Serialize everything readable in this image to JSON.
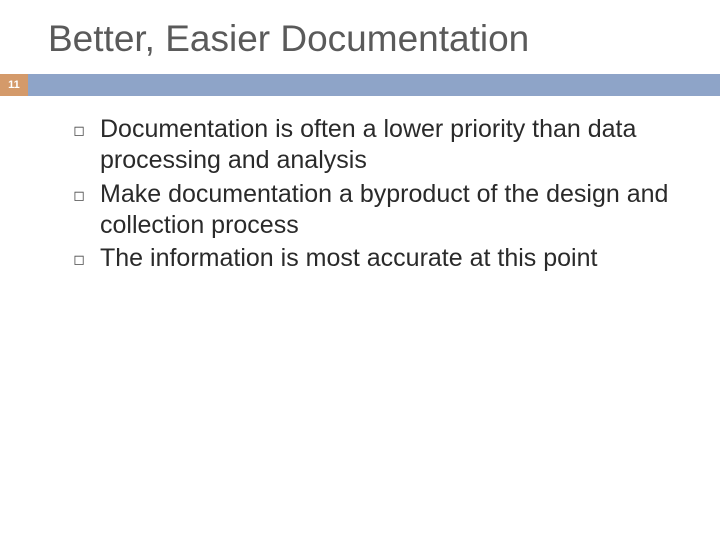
{
  "title": "Better, Easier Documentation",
  "page_number": "11",
  "bullets": [
    "Documentation is often a lower priority than data processing and analysis",
    "Make documentation a byproduct of the design and collection process",
    "The information is most accurate at this point"
  ],
  "colors": {
    "bar": "#8ea4c8",
    "badge": "#d49a6a",
    "title_text": "#5a5a5a"
  }
}
